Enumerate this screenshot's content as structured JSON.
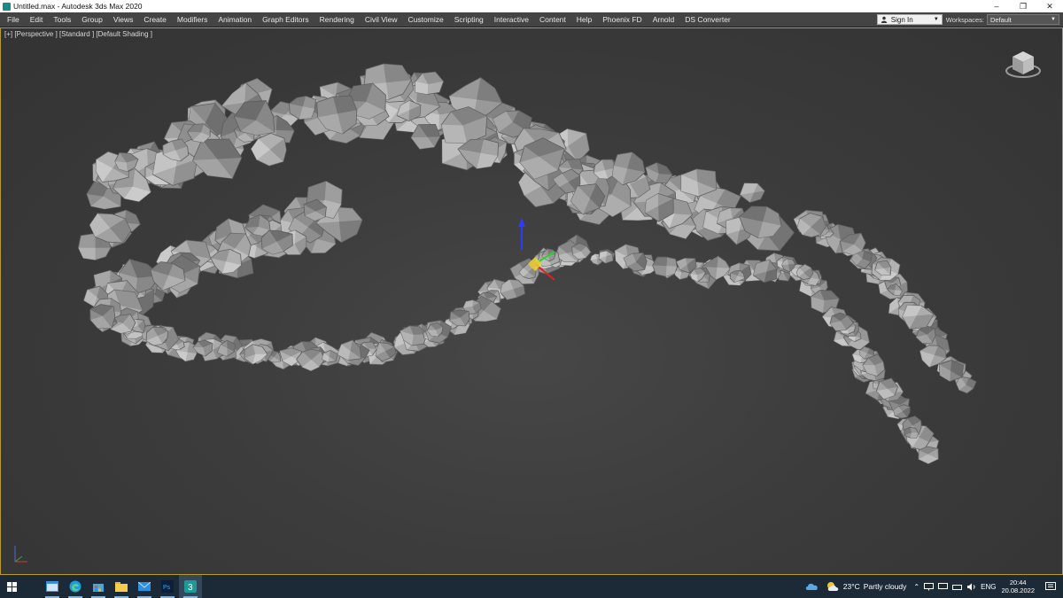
{
  "window": {
    "title": "Untitled.max - Autodesk 3ds Max 2020",
    "controls": [
      "–",
      "❐",
      "✕"
    ]
  },
  "menubar": {
    "items": [
      "File",
      "Edit",
      "Tools",
      "Group",
      "Views",
      "Create",
      "Modifiers",
      "Animation",
      "Graph Editors",
      "Rendering",
      "Civil View",
      "Customize",
      "Scripting",
      "Interactive",
      "Content",
      "Help",
      "Phoenix FD",
      "Arnold",
      "DS Converter"
    ],
    "signin_label": "Sign In",
    "workspaces_label": "Workspaces:",
    "workspace_value": "Default"
  },
  "viewport": {
    "label": "[+] [Perspective ] [Standard ] [Default Shading ]",
    "border_color": "#b89c2a",
    "rock_color": "#9c9c9c"
  },
  "taskbar": {
    "apps": [
      "start-icon",
      "terminal-icon",
      "edge-icon",
      "store-icon",
      "file-explorer-icon",
      "mail-icon",
      "photoshop-icon",
      "3dsmax-icon"
    ],
    "weather_temp": "23°C",
    "weather_text": "Partly cloudy",
    "language": "ENG",
    "time": "20:44",
    "date": "20.08.2022"
  }
}
